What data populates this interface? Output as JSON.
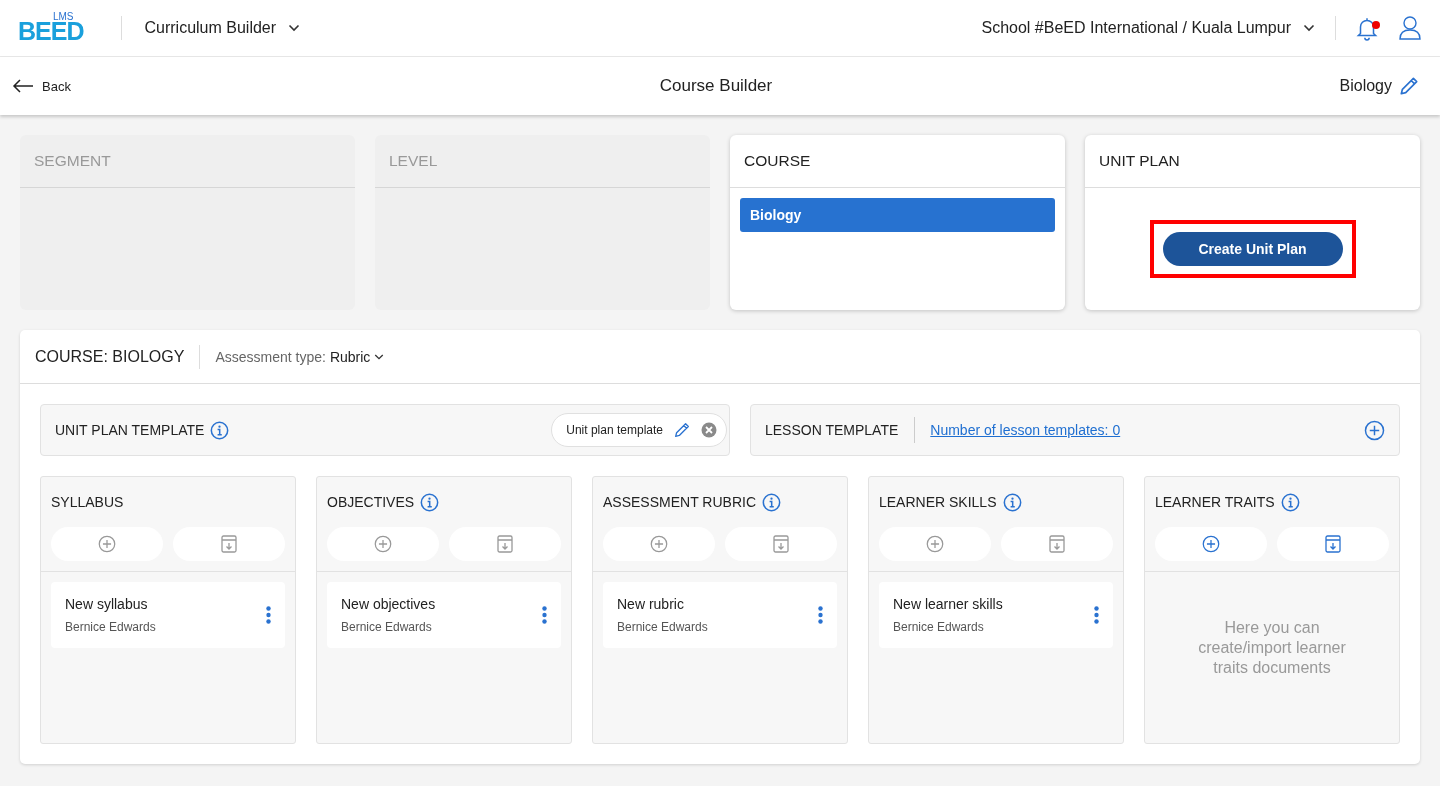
{
  "top_bar": {
    "logo_badge": "LMS",
    "logo": "BEED",
    "app_menu": "Curriculum Builder",
    "school": "School #BeED International / Kuala Lumpur",
    "notifications_unread": true
  },
  "sub_header": {
    "back": "Back",
    "title": "Course Builder",
    "course_name": "Biology"
  },
  "stages": [
    {
      "kind": "list",
      "title": "SEGMENT",
      "disabled": true
    },
    {
      "kind": "list",
      "title": "LEVEL",
      "disabled": true
    },
    {
      "kind": "list",
      "title": "COURSE",
      "disabled": false,
      "items": [
        {
          "label": "Biology",
          "selected": true
        }
      ]
    },
    {
      "kind": "action",
      "title": "UNIT PLAN",
      "disabled": false,
      "action": "Create Unit Plan",
      "highlighted": true
    }
  ],
  "course_panel": {
    "title": "COURSE: BIOLOGY",
    "assessment_label": "Assessment type:",
    "assessment_value": "Rubric",
    "unit_plan_template": {
      "label": "UNIT PLAN TEMPLATE",
      "chip": "Unit plan template"
    },
    "lesson_template": {
      "label": "LESSON TEMPLATE",
      "link": "Number of lesson templates: 0"
    },
    "documents": [
      {
        "title": "SYLLABUS",
        "info": false,
        "enabled": false,
        "items": [
          {
            "name": "New syllabus",
            "author": "Bernice Edwards"
          }
        ]
      },
      {
        "title": "OBJECTIVES",
        "info": true,
        "enabled": false,
        "items": [
          {
            "name": "New objectives",
            "author": "Bernice Edwards"
          }
        ]
      },
      {
        "title": "ASSESSMENT RUBRIC",
        "info": true,
        "enabled": false,
        "items": [
          {
            "name": "New rubric",
            "author": "Bernice Edwards"
          }
        ]
      },
      {
        "title": "LEARNER SKILLS",
        "info": true,
        "enabled": false,
        "items": [
          {
            "name": "New learner skills",
            "author": "Bernice Edwards"
          }
        ]
      },
      {
        "title": "LEARNER TRAITS",
        "info": true,
        "enabled": true,
        "empty_text": "Here you can create/import learner traits documents"
      }
    ]
  }
}
